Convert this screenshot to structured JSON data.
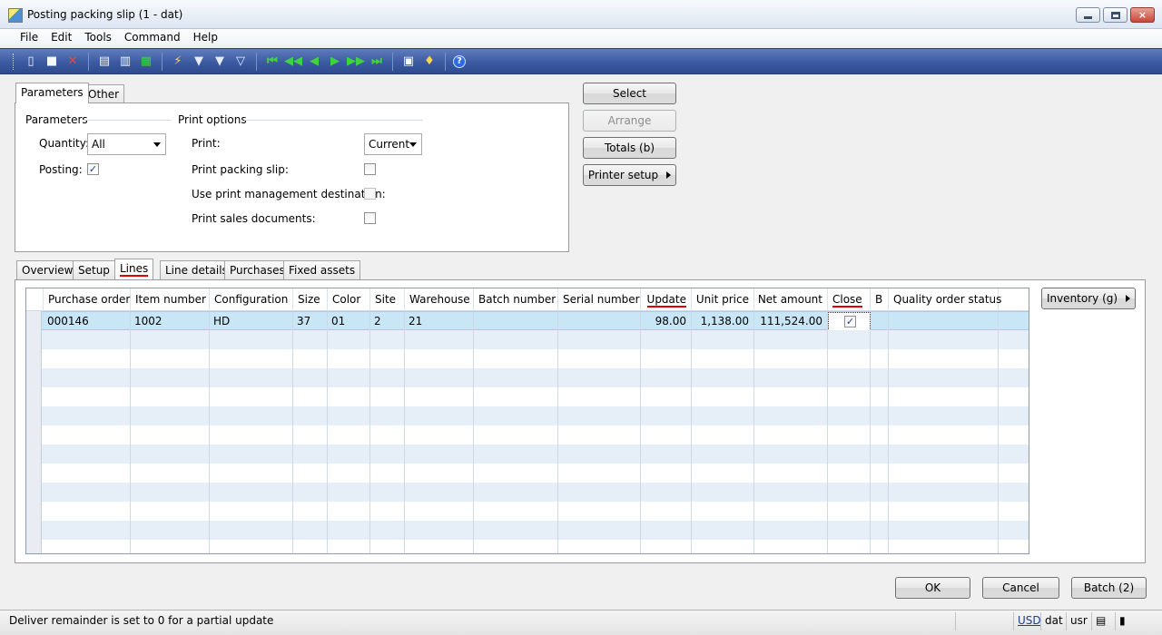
{
  "window": {
    "title": "Posting packing slip (1 - dat)",
    "controls": {
      "minimize": "minimize",
      "maximize": "maximize",
      "close": "×"
    }
  },
  "menu": [
    "File",
    "Edit",
    "Tools",
    "Command",
    "Help"
  ],
  "toolbar": {
    "icons": [
      "new-icon",
      "save-icon",
      "delete-icon",
      "print-icon",
      "print-preview-icon",
      "export-excel-icon",
      "filter-by-selection-icon",
      "filter-by-grid-icon",
      "advanced-filter-icon",
      "clear-filter-icon",
      "first-record-icon",
      "previous-page-icon",
      "previous-record-icon",
      "next-record-icon",
      "next-page-icon",
      "last-record-icon",
      "document-handling-icon",
      "alert-icon",
      "help-icon"
    ],
    "help_glyph": "?"
  },
  "top_tabs": [
    "Parameters",
    "Other"
  ],
  "parameters": {
    "group_title": "Parameters",
    "quantity_label": "Quantity:",
    "quantity_value": "All",
    "posting_label": "Posting:",
    "posting_checked": true
  },
  "print_options": {
    "group_title": "Print options",
    "print_label": "Print:",
    "print_value": "Current",
    "print_packing_slip_label": "Print packing slip:",
    "use_print_mgmt_label": "Use print management destination:",
    "print_sales_docs_label": "Print sales documents:"
  },
  "side_buttons": {
    "select": "Select",
    "arrange": "Arrange",
    "totals": "Totals (b)",
    "printer_setup": "Printer setup"
  },
  "bottom_tabs": [
    "Overview",
    "Setup",
    "Lines",
    "Line details",
    "Purchases",
    "Fixed assets"
  ],
  "active_bottom_tab": "Lines",
  "grid": {
    "columns": [
      "Purchase order",
      "Item number",
      "Configuration",
      "Size",
      "Color",
      "Site",
      "Warehouse",
      "Batch number",
      "Serial number",
      "Update",
      "Unit price",
      "Net amount",
      "Close",
      "B",
      "Quality order status"
    ],
    "rows": [
      {
        "purchase_order": "000146",
        "item_number": "1002",
        "configuration": "HD",
        "size": "37",
        "color": "01",
        "site": "2",
        "warehouse": "21",
        "batch_number": "",
        "serial_number": "",
        "update": "98.00",
        "unit_price": "1,138.00",
        "net_amount": "111,524.00",
        "close": true,
        "b": "",
        "quality_order_status": ""
      }
    ]
  },
  "inventory_button": "Inventory (g)",
  "footer_buttons": {
    "ok": "OK",
    "cancel": "Cancel",
    "batch": "Batch (2)"
  },
  "status": {
    "message": "Deliver remainder is set to 0 for a partial update",
    "currency": "USD",
    "company": "dat",
    "user": "usr"
  },
  "check_glyph": "✓"
}
